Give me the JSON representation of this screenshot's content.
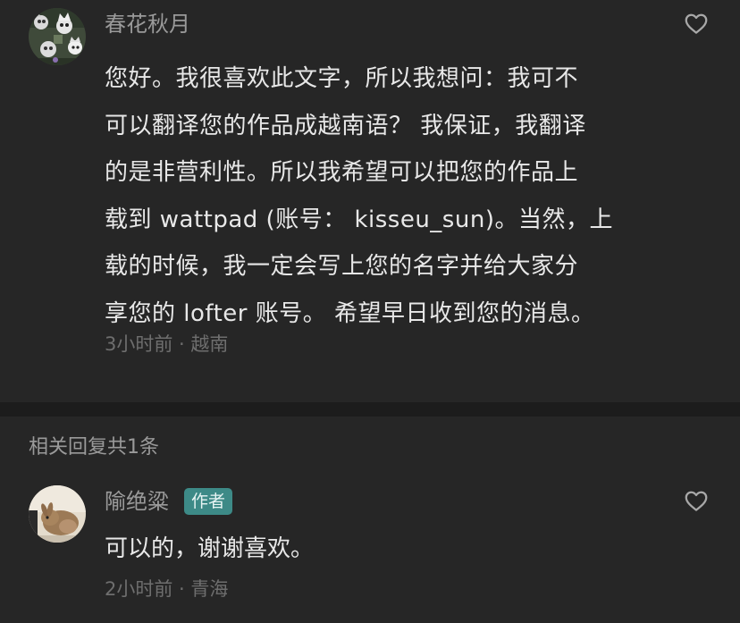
{
  "comment": {
    "username": "春花秋月",
    "like_icon": "heart-outline-icon",
    "body_lines": [
      "您好。我很喜欢此文字，所以我想问：我可不",
      "可以翻译您的作品成越南语？ 我保证，我翻译",
      "的是非营利性。所以我希望可以把您的作品上",
      "载到 wattpad (账号：  kisseu_sun)。当然，上",
      "载的时候，我一定会写上您的名字并给大家分",
      "享您的 lofter 账号。 希望早日收到您的消息。"
    ],
    "meta": "3小时前 · 越南"
  },
  "replies": {
    "header": "相关回复共1条",
    "items": [
      {
        "username": "隃绝粱",
        "badge": "作者",
        "like_icon": "heart-outline-icon",
        "text": "可以的，谢谢喜欢。",
        "meta": "2小时前 · 青海"
      }
    ]
  },
  "colors": {
    "background": "#262626",
    "divider": "#1c1c1c",
    "badge": "#3d8a87",
    "text_primary": "#e8e8e8",
    "text_secondary": "#9a9a9a",
    "text_meta": "#6e6e6e"
  }
}
